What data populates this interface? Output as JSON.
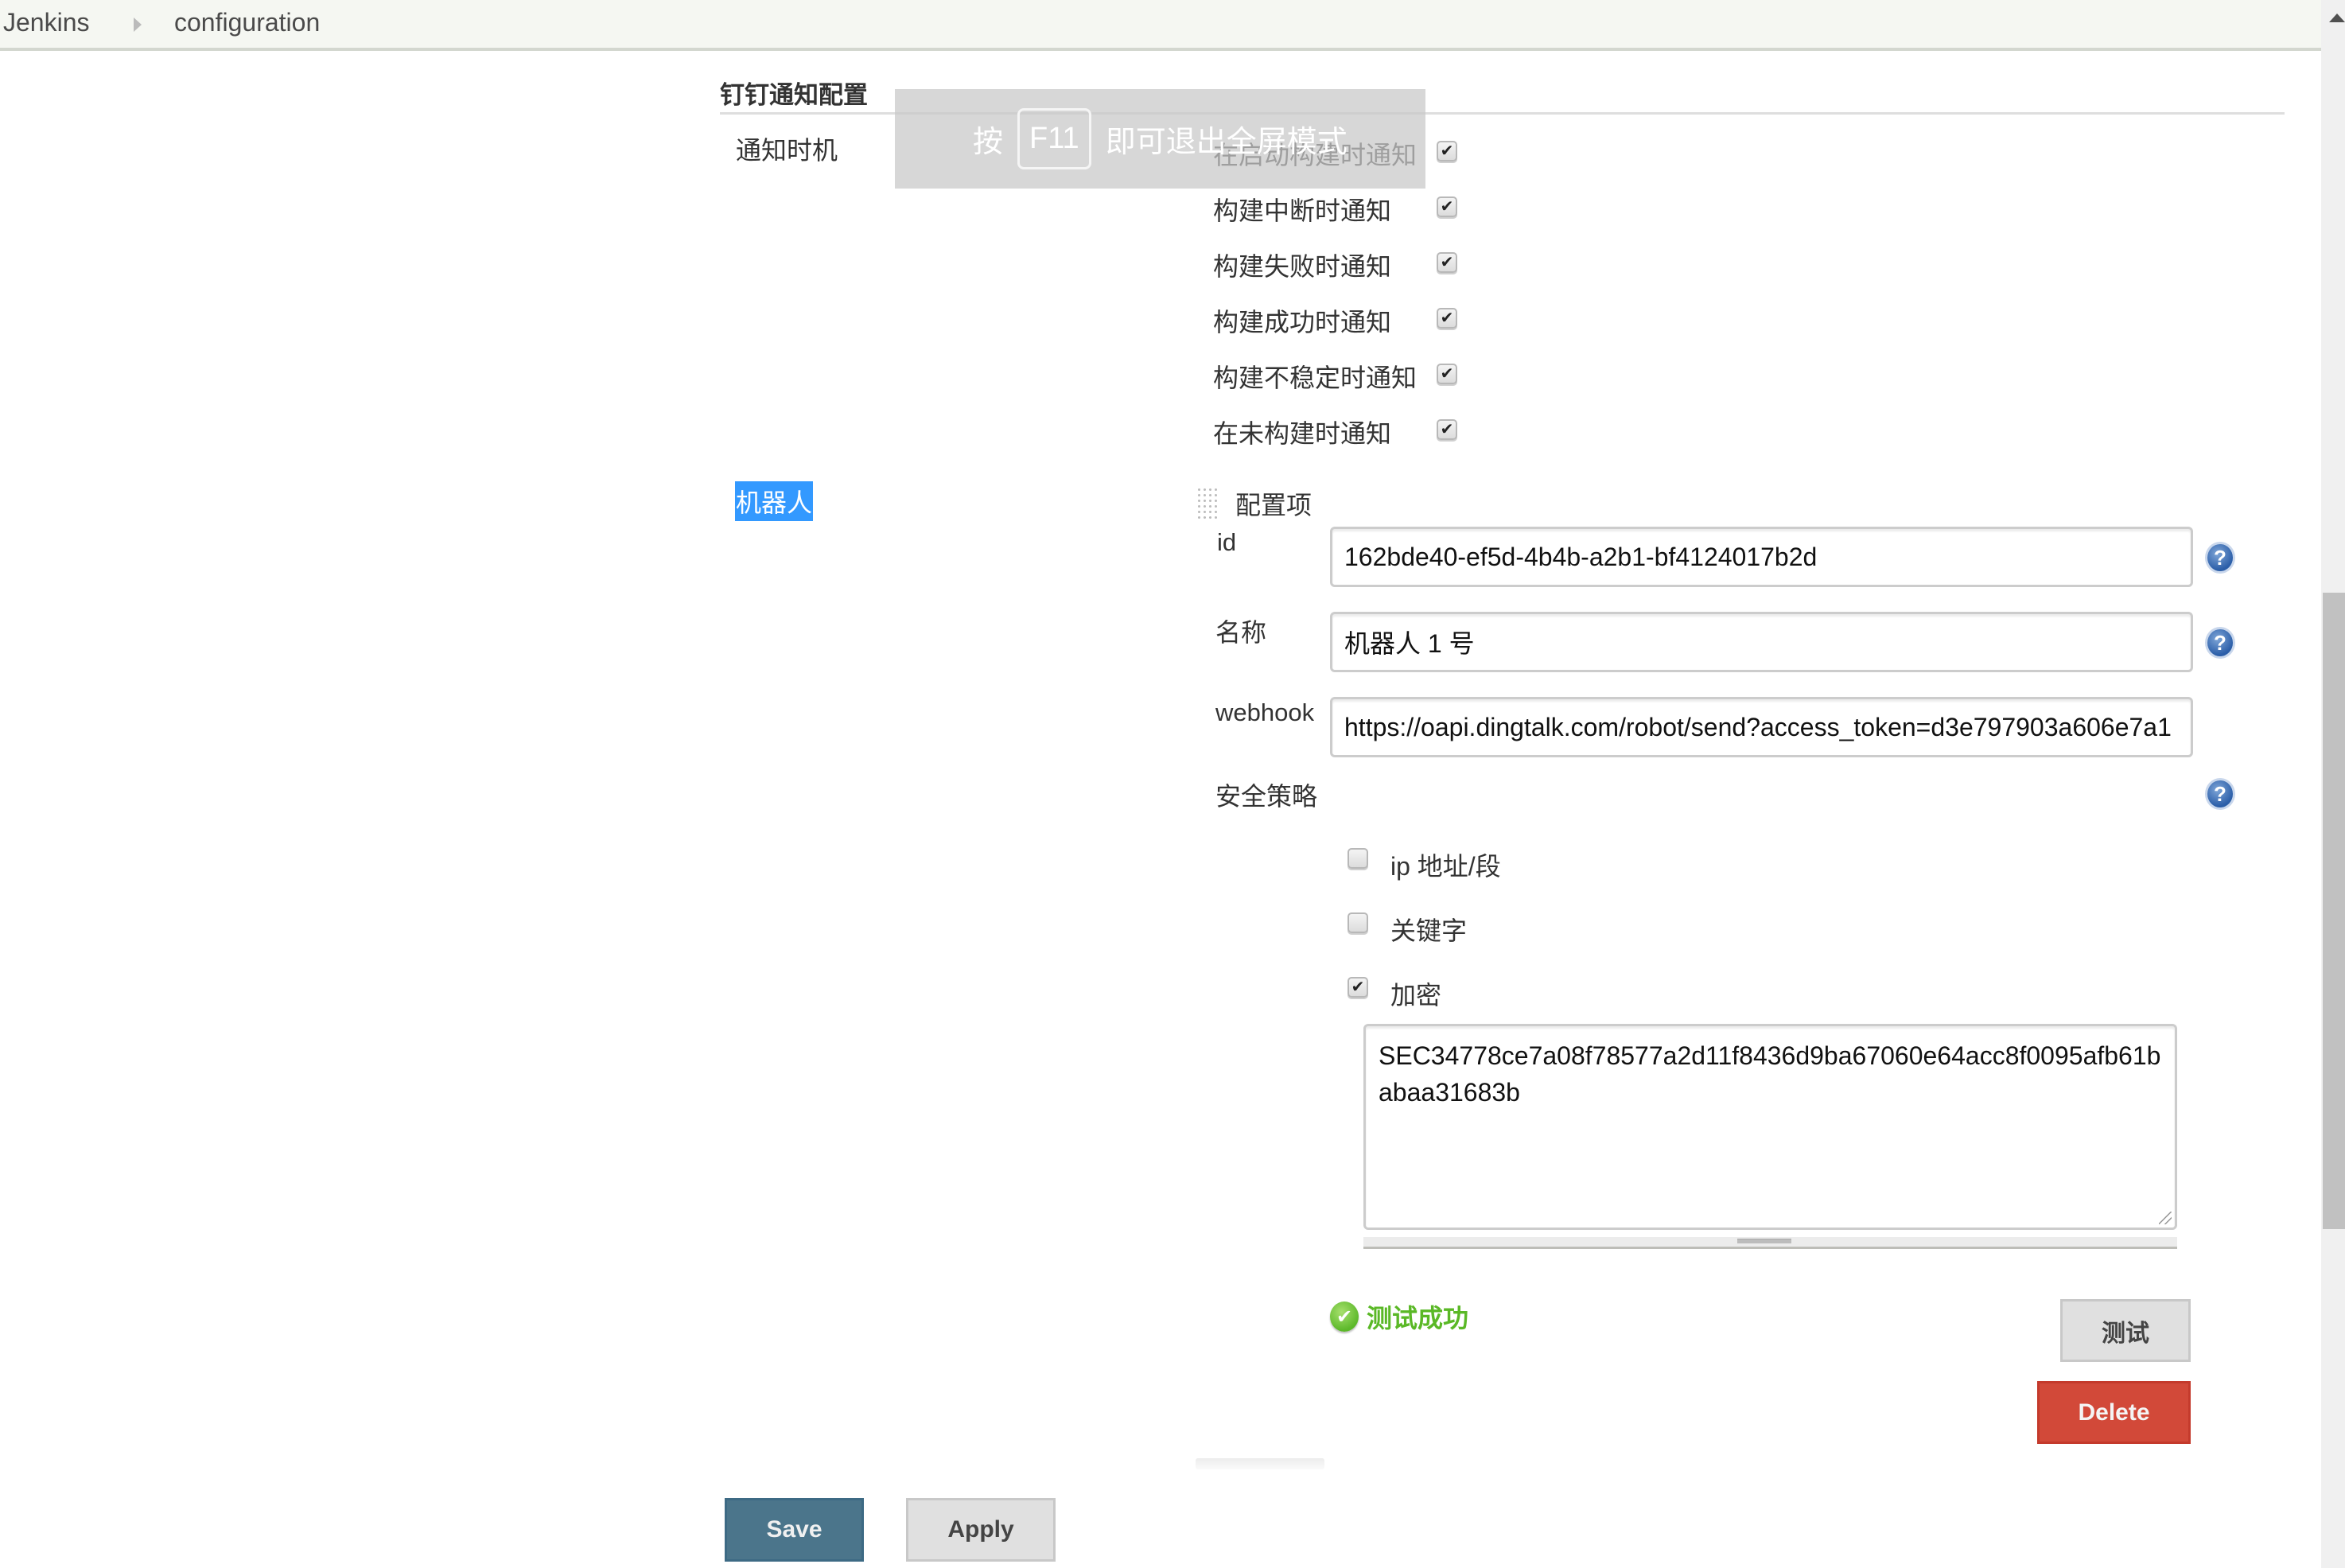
{
  "breadcrumb": {
    "items": [
      "Jenkins",
      "configuration"
    ]
  },
  "fullscreen_toast": {
    "prefix": "按",
    "key": "F11",
    "suffix": "即可退出全屏模式"
  },
  "section": {
    "title": "钉钉通知配置",
    "notify_timing_label": "通知时机",
    "notify_options": [
      {
        "label": "在启动构建时通知",
        "checked": true
      },
      {
        "label": "构建中断时通知",
        "checked": true
      },
      {
        "label": "构建失败时通知",
        "checked": true
      },
      {
        "label": "构建成功时通知",
        "checked": true
      },
      {
        "label": "构建不稳定时通知",
        "checked": true
      },
      {
        "label": "在未构建时通知",
        "checked": true
      }
    ],
    "robot_label": "机器人"
  },
  "robot": {
    "header": "配置项",
    "fields": {
      "id": {
        "label": "id",
        "value": "162bde40-ef5d-4b4b-a2b1-bf4124017b2d"
      },
      "name": {
        "label": "名称",
        "value": "机器人 1 号"
      },
      "webhook": {
        "label": "webhook",
        "value": "https://oapi.dingtalk.com/robot/send?access_token=d3e797903a606e7a1"
      }
    },
    "security_label": "安全策略",
    "security_options": [
      {
        "label": "ip 地址/段",
        "checked": false
      },
      {
        "label": "关键字",
        "checked": false
      },
      {
        "label": "加密",
        "checked": true
      }
    ],
    "secret_value": "SEC34778ce7a08f78577a2d11f8436d9ba67060e64acc8f0095afb61babaa31683b",
    "test_status": "测试成功",
    "test_button": "测试",
    "delete_button": "Delete"
  },
  "footer": {
    "save_label": "Save",
    "apply_label": "Apply"
  },
  "icons": {
    "help": "?",
    "check": "✔"
  },
  "colors": {
    "save_bg": "#4b758b",
    "delete_bg": "#d24939",
    "success_text": "#5ab826",
    "selection": "#3399ff"
  }
}
